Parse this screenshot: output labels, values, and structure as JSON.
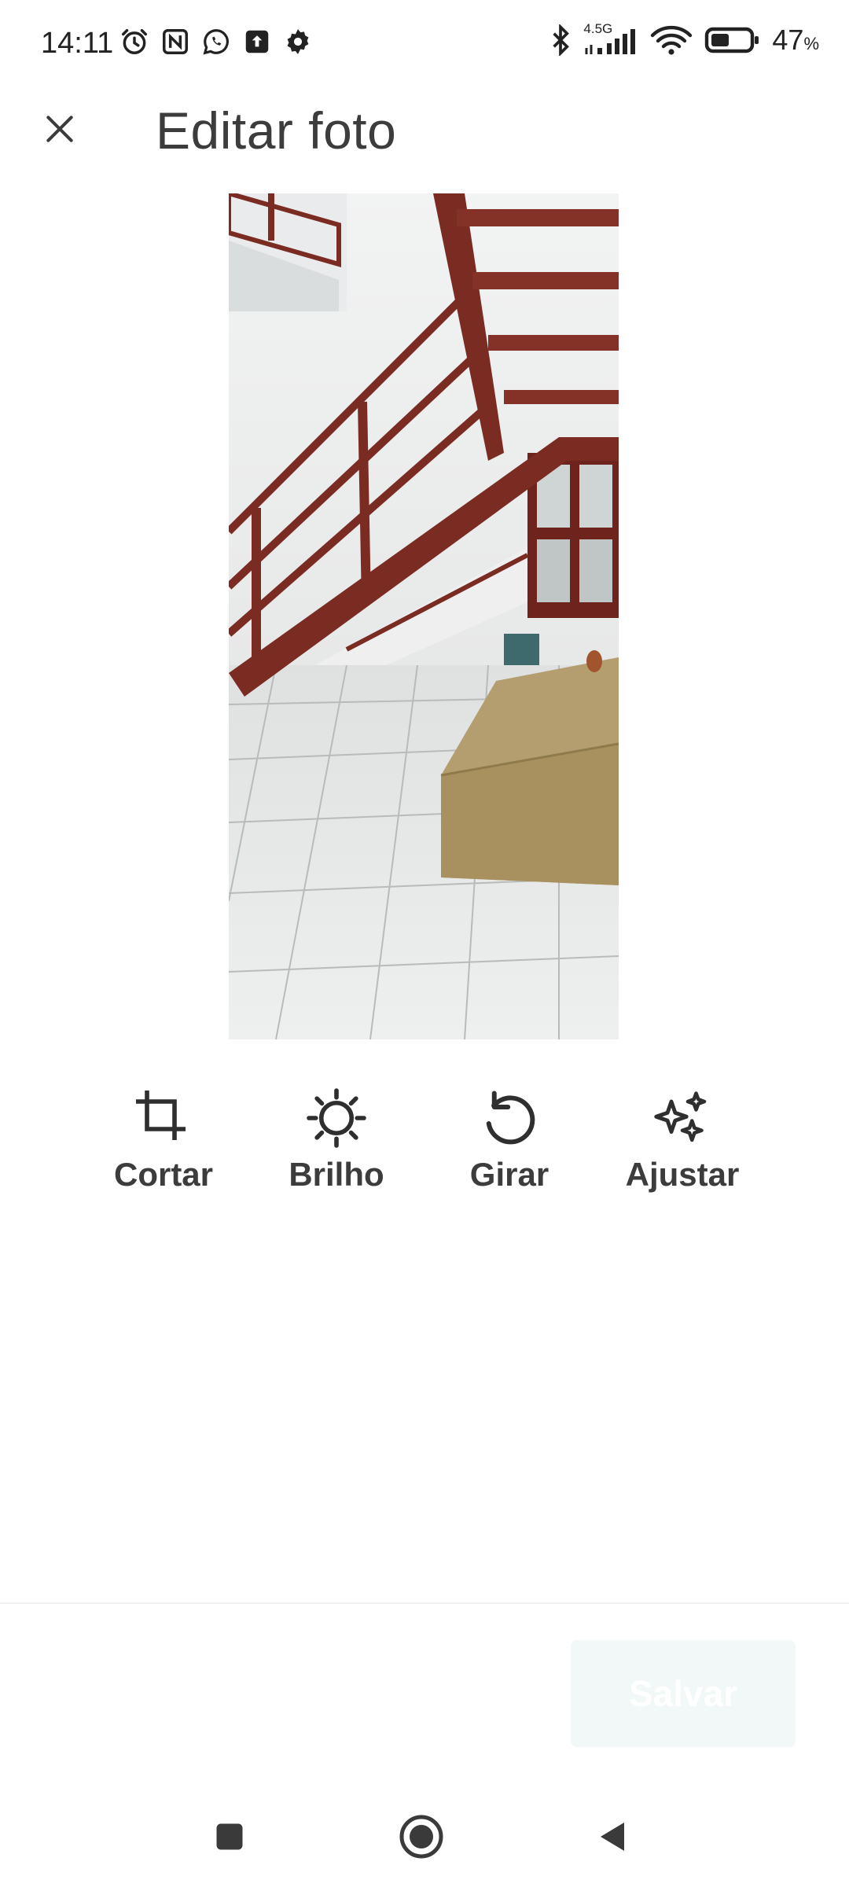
{
  "status_bar": {
    "time": "14:11",
    "left_icons": [
      "alarm-icon",
      "nfc-icon",
      "whatsapp-icon",
      "upload-icon",
      "settings-icon"
    ],
    "network_label": "4.5G",
    "battery_percent": "47",
    "battery_unit": "%",
    "right_icons": [
      "bluetooth-icon",
      "signal-icon",
      "wifi-icon",
      "battery-icon"
    ]
  },
  "app_bar": {
    "title": "Editar foto",
    "close_icon": "close-icon"
  },
  "photo": {
    "subject_icon": "photo-staircase"
  },
  "tools": [
    {
      "label": "Cortar",
      "icon": "crop-icon"
    },
    {
      "label": "Brilho",
      "icon": "brightness-icon"
    },
    {
      "label": "Girar",
      "icon": "rotate-icon"
    },
    {
      "label": "Ajustar",
      "icon": "sparkles-icon"
    }
  ],
  "actions": {
    "save_label": "Salvar",
    "save_enabled": false
  },
  "nav_bar": {
    "items": [
      "recents-icon",
      "home-icon",
      "back-icon"
    ]
  },
  "colors": {
    "text_primary": "#3c3c3c",
    "save_button_bg": "#f2f8f7",
    "save_button_text": "#ffffff"
  }
}
